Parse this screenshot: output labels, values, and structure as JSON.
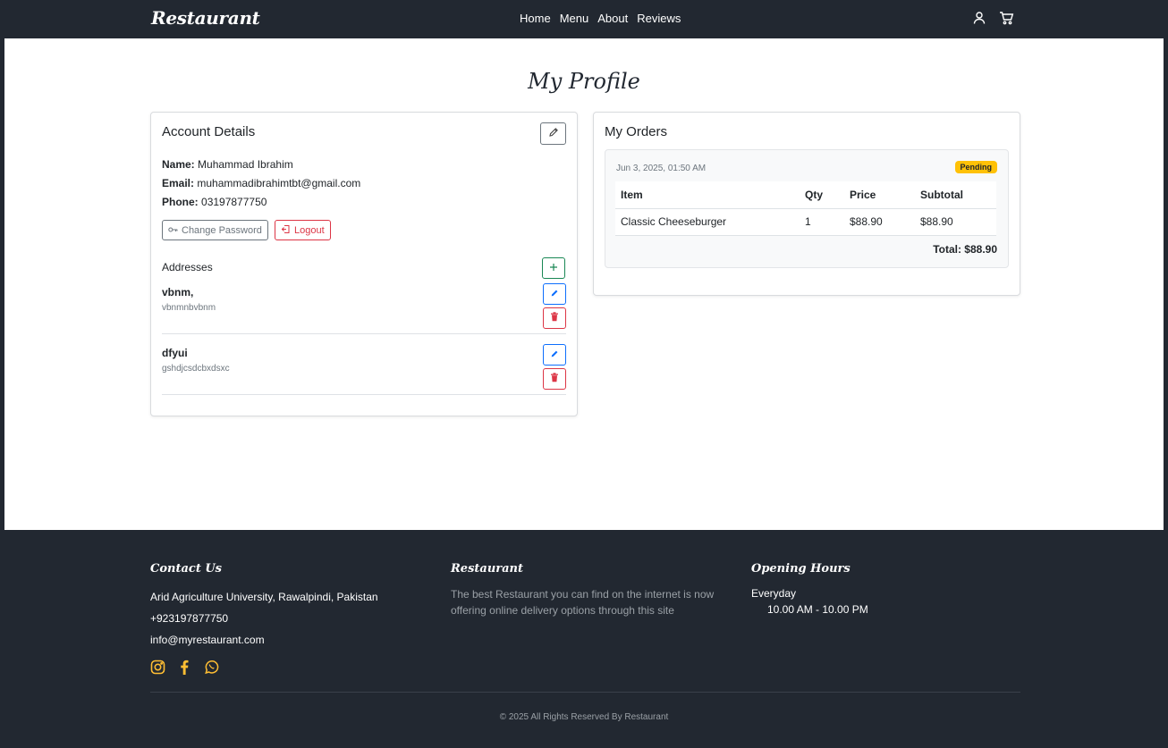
{
  "navbar": {
    "brand": "Restaurant",
    "links": [
      "Home",
      "Menu",
      "About",
      "Reviews"
    ],
    "icons": [
      "user-icon",
      "cart-icon"
    ]
  },
  "page": {
    "title": "My Profile"
  },
  "account": {
    "title": "Account Details",
    "name_label": "Name:",
    "name": "Muhammad Ibrahim",
    "email_label": "Email:",
    "email": "muhammadibrahimtbt@gmail.com",
    "phone_label": "Phone:",
    "phone": "03197877750",
    "change_password": "Change Password",
    "logout": "Logout",
    "addresses_title": "Addresses",
    "addresses": [
      {
        "name": "vbnm,",
        "detail": "vbnmnbvbnm"
      },
      {
        "name": "dfyui",
        "detail": "gshdjcsdcbxdsxc"
      }
    ]
  },
  "orders": {
    "title": "My Orders",
    "list": [
      {
        "date": "Jun 3, 2025, 01:50 AM",
        "status": "Pending",
        "columns": [
          "Item",
          "Qty",
          "Price",
          "Subtotal"
        ],
        "items": [
          {
            "item": "Classic Cheeseburger",
            "qty": "1",
            "price": "$88.90",
            "subtotal": "$88.90"
          }
        ],
        "total": "Total: $88.90"
      }
    ]
  },
  "footer": {
    "contact_title": "Contact Us",
    "address": "Arid Agriculture University, Rawalpindi, Pakistan",
    "phone": "+923197877750",
    "email": "info@myrestaurant.com",
    "about_title": "Restaurant",
    "about_text": "The best Restaurant you can find on the internet is now offering online delivery options through this site",
    "hours_title": "Opening Hours",
    "hours_day": "Everyday",
    "hours_time": "10.00 AM - 10.00 PM",
    "copyright": "© 2025 All Rights Reserved By Restaurant",
    "social_icons": [
      "instagram-icon",
      "facebook-icon",
      "whatsapp-icon"
    ]
  },
  "colors": {
    "dark": "#222831",
    "accent": "#ffbe33",
    "badge": "#ffc107",
    "danger": "#dc3545",
    "primary": "#0d6efd",
    "success": "#198754"
  }
}
